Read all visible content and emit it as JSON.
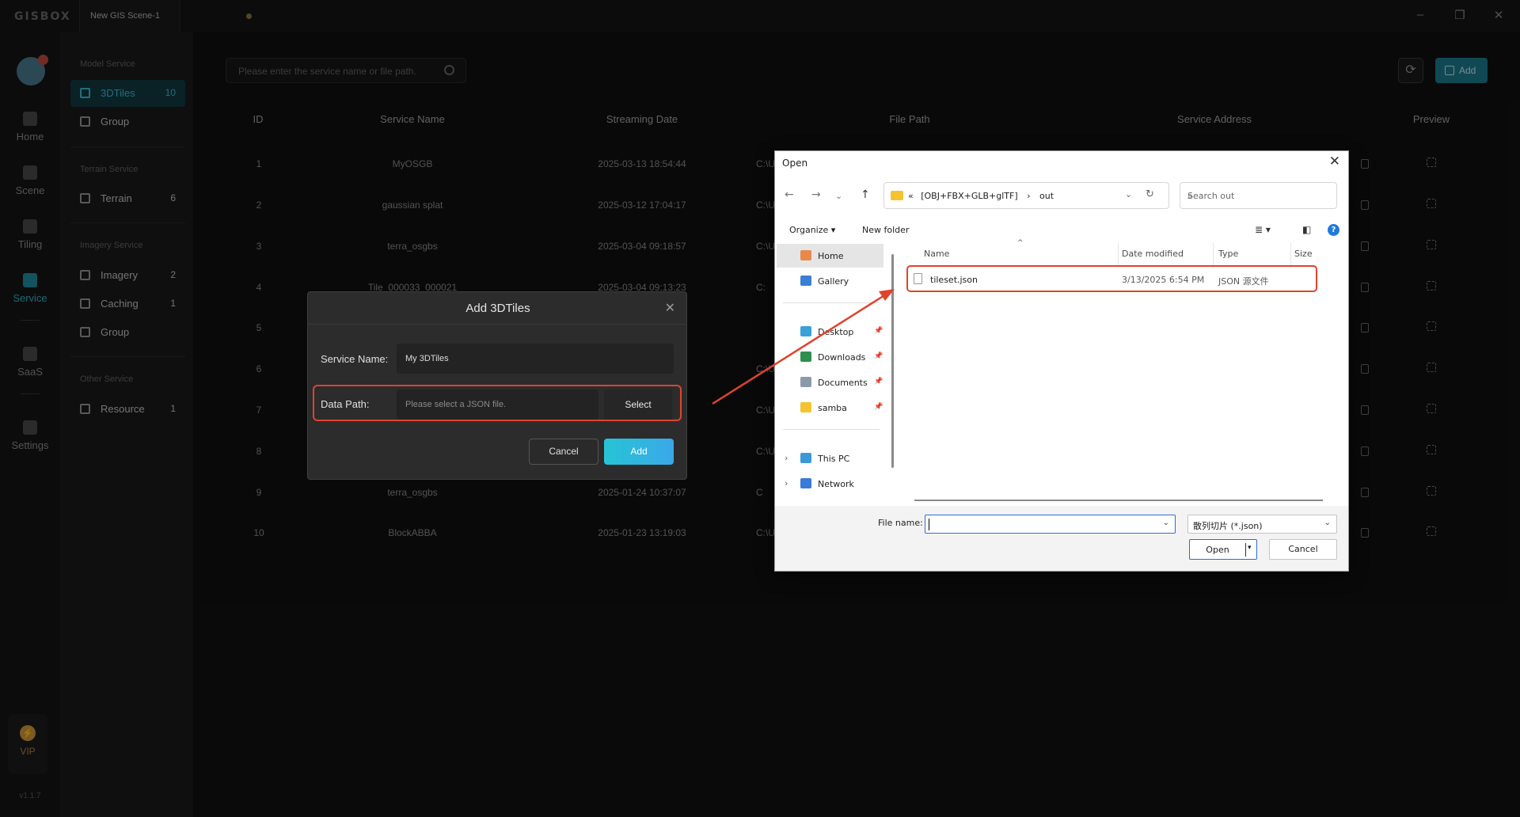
{
  "app": {
    "logo_text": "GISBOX",
    "scene_tab": "New GIS Scene-1",
    "window_controls": [
      "minimize-icon",
      "restore-icon",
      "close-icon"
    ]
  },
  "rail": {
    "items": [
      {
        "label": "Home",
        "icon": "home-icon"
      },
      {
        "label": "Scene",
        "icon": "scene-icon"
      },
      {
        "label": "Tiling",
        "icon": "tiling-icon"
      },
      {
        "label": "Service",
        "icon": "service-icon",
        "active": true
      },
      {
        "label": "SaaS",
        "icon": "saas-icon"
      },
      {
        "label": "Settings",
        "icon": "settings-icon"
      }
    ],
    "vip_label": "VIP",
    "version": "v1.1.7"
  },
  "sidebar": {
    "model_title": "Model Service",
    "tiles3d_label": "3DTiles",
    "tiles3d_count": "10",
    "model_group_label": "Group",
    "terrain_title": "Terrain Service",
    "terrain_label": "Terrain",
    "terrain_count": "6",
    "imagery_title": "Imagery Service",
    "imagery_label": "Imagery",
    "imagery_count": "2",
    "caching_label": "Caching",
    "caching_count": "1",
    "imagery_group_label": "Group",
    "other_title": "Other Service",
    "resource_label": "Resource",
    "resource_count": "1"
  },
  "main": {
    "search_placeholder": "Please enter the service name or file path.",
    "add_label": "Add",
    "columns": {
      "id": "ID",
      "name": "Service Name",
      "date": "Streaming Date",
      "path": "File Path",
      "address": "Service Address",
      "preview": "Preview"
    },
    "rows": [
      {
        "id": "1",
        "name": "MyOSGB",
        "date": "2025-03-13 18:54:44",
        "path": "C:\\U"
      },
      {
        "id": "2",
        "name": "gaussian splat",
        "date": "2025-03-12 17:04:17",
        "path": "C:\\U"
      },
      {
        "id": "3",
        "name": "terra_osgbs",
        "date": "2025-03-04 09:18:57",
        "path": "C:\\U"
      },
      {
        "id": "4",
        "name": "Tile_000033_000021",
        "date": "2025-03-04 09:13:23",
        "path": "C:"
      },
      {
        "id": "5",
        "name": "",
        "date": "",
        "path": ""
      },
      {
        "id": "6",
        "name": "",
        "date": "",
        "path": "C:\\U"
      },
      {
        "id": "7",
        "name": "",
        "date": "",
        "path": "C:\\U"
      },
      {
        "id": "8",
        "name": "",
        "date": "",
        "path": "C:\\U"
      },
      {
        "id": "9",
        "name": "terra_osgbs",
        "date": "2025-01-24 10:37:07",
        "path": "C"
      },
      {
        "id": "10",
        "name": "BlockABBA",
        "date": "2025-01-23 13:19:03",
        "path": "C:\\U"
      }
    ]
  },
  "modal": {
    "title": "Add 3DTiles",
    "service_name_label": "Service Name:",
    "service_name_value": "My 3DTiles",
    "data_path_label": "Data Path:",
    "data_path_placeholder": "Please select a JSON file.",
    "select_label": "Select",
    "cancel_label": "Cancel",
    "add_label": "Add"
  },
  "dialog": {
    "title": "Open",
    "address_prefix": "«",
    "address_folder": "[OBJ+FBX+GLB+glTF]",
    "address_sep": "›",
    "address_current": "out",
    "search_placeholder": "Search out",
    "organize_label": "Organize ▾",
    "new_folder_label": "New folder",
    "nav": [
      {
        "label": "Home",
        "icon": "home-icon",
        "color": "#e8884a"
      },
      {
        "label": "Gallery",
        "icon": "gallery-icon",
        "color": "#3b7fd4"
      },
      {
        "label": "Desktop",
        "icon": "desktop-icon",
        "color": "#3aa0d8"
      },
      {
        "label": "Downloads",
        "icon": "download-icon",
        "color": "#2e8f4e"
      },
      {
        "label": "Documents",
        "icon": "documents-icon",
        "color": "#8a9aaa"
      },
      {
        "label": "samba",
        "icon": "folder-icon",
        "color": "#f4c430"
      },
      {
        "label": "This PC",
        "icon": "pc-icon",
        "color": "#3a9ad8"
      },
      {
        "label": "Network",
        "icon": "network-icon",
        "color": "#3a7ad8"
      }
    ],
    "columns": {
      "name": "Name",
      "date": "Date modified",
      "type": "Type",
      "size": "Size"
    },
    "file": {
      "name": "tileset.json",
      "date": "3/13/2025 6:54 PM",
      "type": "JSON 源文件"
    },
    "file_name_label": "File name:",
    "file_type": "散列切片 (*.json)",
    "open_label": "Open",
    "cancel_label": "Cancel"
  },
  "colors": {
    "accent": "#2fb6d1",
    "highlight": "#e0432e"
  }
}
